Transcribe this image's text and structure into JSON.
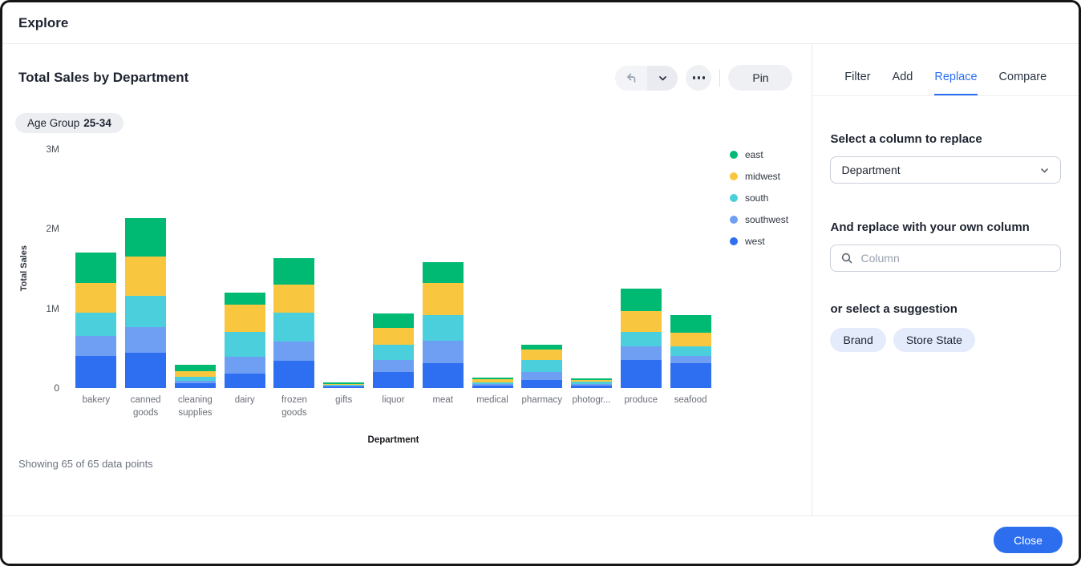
{
  "window": {
    "title": "Explore"
  },
  "chart_header": {
    "title": "Total Sales by Department",
    "pin_label": "Pin"
  },
  "filter_chip": {
    "label": "Age Group",
    "value": "25-34"
  },
  "status_text": "Showing 65 of 65 data points",
  "panel": {
    "tabs": [
      {
        "label": "Filter",
        "active": false
      },
      {
        "label": "Add",
        "active": false
      },
      {
        "label": "Replace",
        "active": true
      },
      {
        "label": "Compare",
        "active": false
      }
    ],
    "select_label": "Select a column to replace",
    "dropdown_value": "Department",
    "replace_label": "And replace with your own column",
    "search_placeholder": "Column",
    "suggestion_label": "or select a suggestion",
    "suggestions": [
      "Brand",
      "Store State"
    ]
  },
  "footer": {
    "close_label": "Close"
  },
  "colors": {
    "accent_blue": "#2b6ff0",
    "close_button": "#2d6eef",
    "active_tab": "#2b6ff0",
    "suggestion_chip_bg": "#e4ebfb",
    "filter_chip_bg": "#eceef2",
    "toolbar_bg": "#eef0f4"
  },
  "chart_data": {
    "type": "bar",
    "stacked": true,
    "title": "Total Sales by Department",
    "xlabel": "Department",
    "ylabel": "Total Sales",
    "ylim": [
      0,
      3000000
    ],
    "yticks": [
      "0",
      "1M",
      "2M",
      "3M"
    ],
    "grid": false,
    "legend_position": "right",
    "categories": [
      "bakery",
      "canned goods",
      "cleaning supplies",
      "dairy",
      "frozen goods",
      "gifts",
      "liquor",
      "meat",
      "medical",
      "pharmacy",
      "photography",
      "produce",
      "seafood"
    ],
    "category_display": [
      "bakery",
      "canned goods",
      "cleaning supplies",
      "dairy",
      "frozen goods",
      "gifts",
      "liquor",
      "meat",
      "medical",
      "pharmacy",
      "photogr...",
      "produce",
      "seafood"
    ],
    "series": [
      {
        "name": "east",
        "color": "#00ba74",
        "values": [
          380000,
          480000,
          80000,
          150000,
          330000,
          20000,
          190000,
          260000,
          20000,
          60000,
          20000,
          280000,
          220000
        ]
      },
      {
        "name": "midwest",
        "color": "#f9c73f",
        "values": [
          370000,
          490000,
          70000,
          350000,
          350000,
          10000,
          210000,
          400000,
          40000,
          130000,
          20000,
          270000,
          180000
        ]
      },
      {
        "name": "south",
        "color": "#4bcfdc",
        "values": [
          290000,
          390000,
          50000,
          310000,
          370000,
          10000,
          190000,
          330000,
          20000,
          150000,
          30000,
          180000,
          120000
        ]
      },
      {
        "name": "southwest",
        "color": "#6e9ff3",
        "values": [
          260000,
          330000,
          30000,
          210000,
          240000,
          10000,
          150000,
          280000,
          20000,
          100000,
          20000,
          170000,
          90000
        ]
      },
      {
        "name": "west",
        "color": "#2d6ff0",
        "values": [
          400000,
          440000,
          60000,
          180000,
          340000,
          20000,
          200000,
          310000,
          30000,
          100000,
          30000,
          350000,
          310000
        ]
      }
    ],
    "totals_note": "5 regions x 13 departments = 65 data points"
  }
}
